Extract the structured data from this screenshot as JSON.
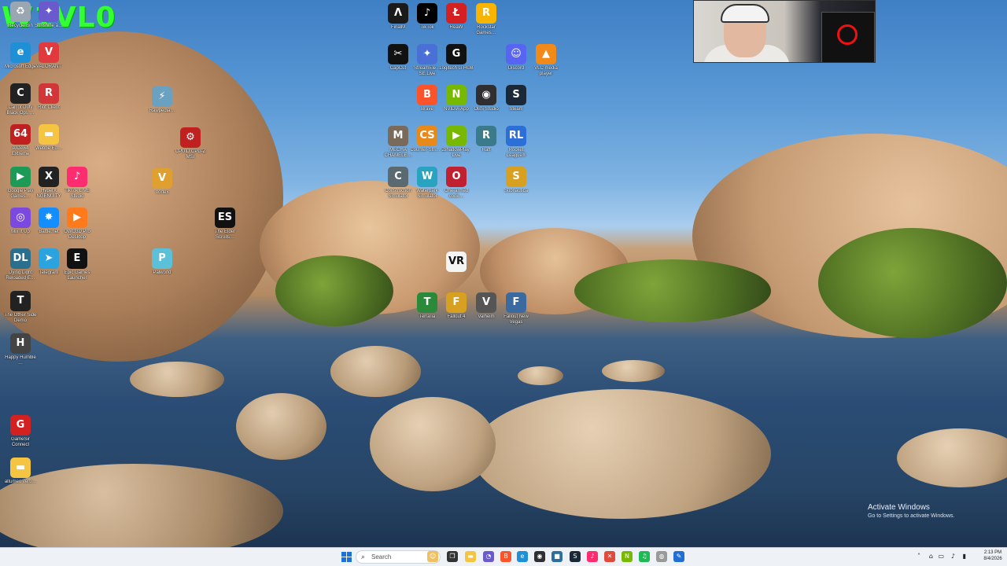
{
  "watermark": "W1VL0",
  "desktop_icons": [
    {
      "name": "recycle-bin-icon",
      "label": "Recycle Bin",
      "glyph": "♻",
      "bg": "#9aa6b2"
    },
    {
      "name": "icon-2",
      "label": "Sunshine a…",
      "glyph": "✦",
      "bg": "#6a5acd"
    },
    {
      "name": "edge-icon",
      "label": "Microsoft Edge",
      "glyph": "e",
      "bg": "#1f8fd6"
    },
    {
      "name": "valorant-icon",
      "label": "VALORANT",
      "glyph": "V",
      "bg": "#e03a3e"
    },
    {
      "name": "call-of-duty-icon",
      "label": "Call of Duty Black Ops …",
      "glyph": "C",
      "bg": "#222"
    },
    {
      "name": "riot-client-icon",
      "label": "Riot Client",
      "glyph": "R",
      "bg": "#d13639"
    },
    {
      "name": "aida64-icon",
      "label": "AIDA64 Extreme",
      "glyph": "64",
      "bg": "#c02020"
    },
    {
      "name": "folder-webbe-icon",
      "label": "Webbe Ed…",
      "glyph": "▬",
      "bg": "#f5c542"
    },
    {
      "name": "google-play-icon",
      "label": "Google Play Games…",
      "glyph": "▶",
      "bg": "#1e9a57"
    },
    {
      "name": "hyperx-icon",
      "label": "HyperX NGENUITY",
      "glyph": "X",
      "bg": "#222"
    },
    {
      "name": "tiktok-live-icon",
      "label": "TikTok LIVE Studio",
      "glyph": "♪",
      "bg": "#ff2d6f"
    },
    {
      "name": "mix-it-up-icon",
      "label": "Mix It Up",
      "glyph": "◎",
      "bg": "#7b48e0"
    },
    {
      "name": "battlenet-icon",
      "label": "Battle.net",
      "glyph": "✸",
      "bg": "#148eff"
    },
    {
      "name": "owo3d-icon",
      "label": "OWO3D Pro Desktop",
      "glyph": "▶",
      "bg": "#ff7a1a"
    },
    {
      "name": "dying-light-icon",
      "label": "Dying Light Reloaded E…",
      "glyph": "DL",
      "bg": "#2b6f8f"
    },
    {
      "name": "telegram-icon",
      "label": "Telegram",
      "glyph": "➤",
      "bg": "#2aa3df"
    },
    {
      "name": "epic-games-icon",
      "label": "Epic Games Launcher",
      "glyph": "E",
      "bg": "#111"
    },
    {
      "name": "tos-demo-icon",
      "label": "The Other Side Demo",
      "glyph": "T",
      "bg": "#222"
    },
    {
      "name": "humble-icon",
      "label": "Happy Humble …",
      "glyph": "H",
      "bg": "#444"
    },
    {
      "name": "gamesir-icon",
      "label": "GameSir Connect",
      "glyph": "G",
      "bg": "#d32020"
    },
    {
      "name": "folder-alt-icon",
      "label": "altumeo verti…",
      "glyph": "▬",
      "bg": "#f5c542"
    },
    {
      "name": "rawpedia-icon",
      "label": "Rawpedia…",
      "glyph": "⚡",
      "bg": "#6aa0c0"
    },
    {
      "name": "cpuid-icon",
      "label": "CPUID CPU-Z MSI",
      "glyph": "⚙",
      "bg": "#c02020"
    },
    {
      "name": "vortex-icon",
      "label": "Vortex",
      "glyph": "V",
      "bg": "#e0a030"
    },
    {
      "name": "elder-scrolls-icon",
      "label": "The Elder Scrolls…",
      "glyph": "ES",
      "bg": "#111"
    },
    {
      "name": "palworld-icon",
      "label": "Palworld",
      "glyph": "P",
      "bg": "#5cc0d8"
    },
    {
      "name": "finalm-icon",
      "label": "FinalM",
      "glyph": "Λ",
      "bg": "#1a1a1a"
    },
    {
      "name": "tiktok-icon",
      "label": "TikTok",
      "glyph": "♪",
      "bg": "#000"
    },
    {
      "name": "reaw-icon",
      "label": "ReaW",
      "glyph": "Ł",
      "bg": "#d42020"
    },
    {
      "name": "rockstar-icon",
      "label": "Rockstar Games…",
      "glyph": "R",
      "bg": "#f7b500"
    },
    {
      "name": "capcut-icon",
      "label": "CapCut",
      "glyph": "✂",
      "bg": "#111"
    },
    {
      "name": "streamelements-icon",
      "label": "StreamEle… SE.Live",
      "glyph": "✦",
      "bg": "#4a6fd6"
    },
    {
      "name": "logitech-icon",
      "label": "Logitech G HUB",
      "glyph": "G",
      "bg": "#111"
    },
    {
      "name": "discord-icon",
      "label": "Discord",
      "glyph": "☺",
      "bg": "#5865f2"
    },
    {
      "name": "vlc-icon",
      "label": "VLC media player",
      "glyph": "▲",
      "bg": "#f28a1a"
    },
    {
      "name": "brave-icon",
      "label": "Brave",
      "glyph": "B",
      "bg": "#fb542b"
    },
    {
      "name": "nvidia-app-icon",
      "label": "NVIDIA App",
      "glyph": "N",
      "bg": "#76b900"
    },
    {
      "name": "obs-icon",
      "label": "OBS Studio",
      "glyph": "◉",
      "bg": "#302e31"
    },
    {
      "name": "steam-icon",
      "label": "Steam",
      "glyph": "S",
      "bg": "#1b2838"
    },
    {
      "name": "chameleon-icon",
      "label": "MECHA CHAMELE…",
      "glyph": "M",
      "bg": "#7a6a5a"
    },
    {
      "name": "counterstrike-icon",
      "label": "Counter-Stri… 2",
      "glyph": "CS",
      "bg": "#e88a1a"
    },
    {
      "name": "shadowplay-icon",
      "label": "ShadowPlay Live",
      "glyph": "▶",
      "bg": "#76b900"
    },
    {
      "name": "raft-icon",
      "label": "Raft",
      "glyph": "R",
      "bg": "#3b7a8a"
    },
    {
      "name": "rocket-league-icon",
      "label": "Rocket League®",
      "glyph": "RL",
      "bg": "#2c6fd6"
    },
    {
      "name": "construction-sim-icon",
      "label": "Construction Simulator",
      "glyph": "C",
      "bg": "#5a6a70"
    },
    {
      "name": "waterpark-icon",
      "label": "Waterpark Simulator",
      "glyph": "W",
      "bg": "#2aa3c0"
    },
    {
      "name": "one-armed-icon",
      "label": "One-armed cook…",
      "glyph": "O",
      "bg": "#c02030"
    },
    {
      "name": "subnautica-icon",
      "label": "Subnautica",
      "glyph": "S",
      "bg": "#d8a020"
    },
    {
      "name": "vr-icon",
      "label": "",
      "glyph": "VR",
      "bg": "#f4f4f4"
    },
    {
      "name": "terraria-icon",
      "label": "Terraria",
      "glyph": "T",
      "bg": "#2a8a3a"
    },
    {
      "name": "fallout4-icon",
      "label": "Fallout 4",
      "glyph": "F",
      "bg": "#d8a020"
    },
    {
      "name": "valheim-icon",
      "label": "Valheim",
      "glyph": "V",
      "bg": "#555"
    },
    {
      "name": "fallout-nv-icon",
      "label": "Fallout New Vegas",
      "glyph": "F",
      "bg": "#3a6aa0"
    }
  ],
  "activate_windows": {
    "title": "Activate Windows",
    "subtitle": "Go to Settings to activate Windows."
  },
  "taskbar": {
    "search_placeholder": "Search",
    "search_icon": "search-icon",
    "apps": [
      {
        "name": "taskbar-emoji-icon",
        "glyph": "☺",
        "bg": "#f0c060"
      },
      {
        "name": "taskbar-taskview-icon",
        "glyph": "❐",
        "bg": "#333"
      },
      {
        "name": "taskbar-explorer-icon",
        "glyph": "▬",
        "bg": "#f5c542"
      },
      {
        "name": "taskbar-icon-4",
        "glyph": "◔",
        "bg": "#6a5acd"
      },
      {
        "name": "taskbar-brave-icon",
        "glyph": "B",
        "bg": "#fb542b"
      },
      {
        "name": "taskbar-edge-icon",
        "glyph": "e",
        "bg": "#1f8fd6"
      },
      {
        "name": "taskbar-obs-icon",
        "glyph": "◉",
        "bg": "#302e31"
      },
      {
        "name": "taskbar-icon-8",
        "glyph": "■",
        "bg": "#2a6f9f"
      },
      {
        "name": "taskbar-steam-icon",
        "glyph": "S",
        "bg": "#1b2838"
      },
      {
        "name": "taskbar-tiktok-icon",
        "glyph": "♪",
        "bg": "#ff2d6f"
      },
      {
        "name": "taskbar-icon-11",
        "glyph": "✕",
        "bg": "#e04a3a"
      },
      {
        "name": "taskbar-nvidia-icon",
        "glyph": "N",
        "bg": "#76b900"
      },
      {
        "name": "taskbar-spotify-icon",
        "glyph": "♫",
        "bg": "#1db954"
      },
      {
        "name": "taskbar-icon-14",
        "glyph": "◍",
        "bg": "#999"
      },
      {
        "name": "taskbar-icon-15",
        "glyph": "✎",
        "bg": "#1f6fd6"
      }
    ]
  },
  "tray": {
    "time": "2:13 PM",
    "date": "8/4/2026"
  }
}
